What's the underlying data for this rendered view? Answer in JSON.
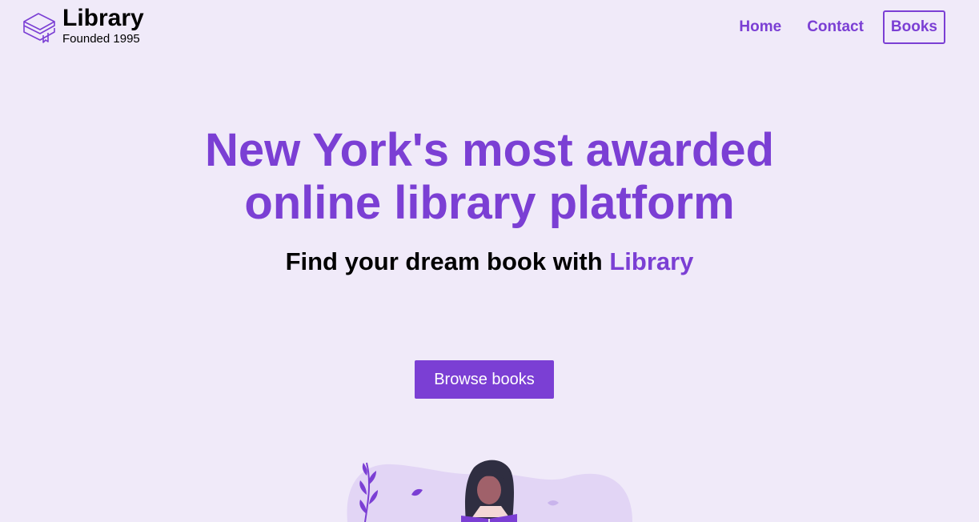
{
  "header": {
    "logo_title": "Library",
    "logo_subtitle": "Founded 1995",
    "nav": {
      "home": "Home",
      "contact": "Contact",
      "books": "Books"
    }
  },
  "hero": {
    "title_line1": "New York's most awarded",
    "title_line2": "online library platform",
    "subtitle_prefix": "Find your dream book with",
    "subtitle_accent": "Library"
  },
  "cta": {
    "label": "Browse books"
  },
  "colors": {
    "accent": "#7b3fd4",
    "background": "#f0eaf9",
    "text": "#000000"
  },
  "icons": {
    "logo": "books-stack-icon",
    "illustration": "woman-reading-illustration"
  }
}
